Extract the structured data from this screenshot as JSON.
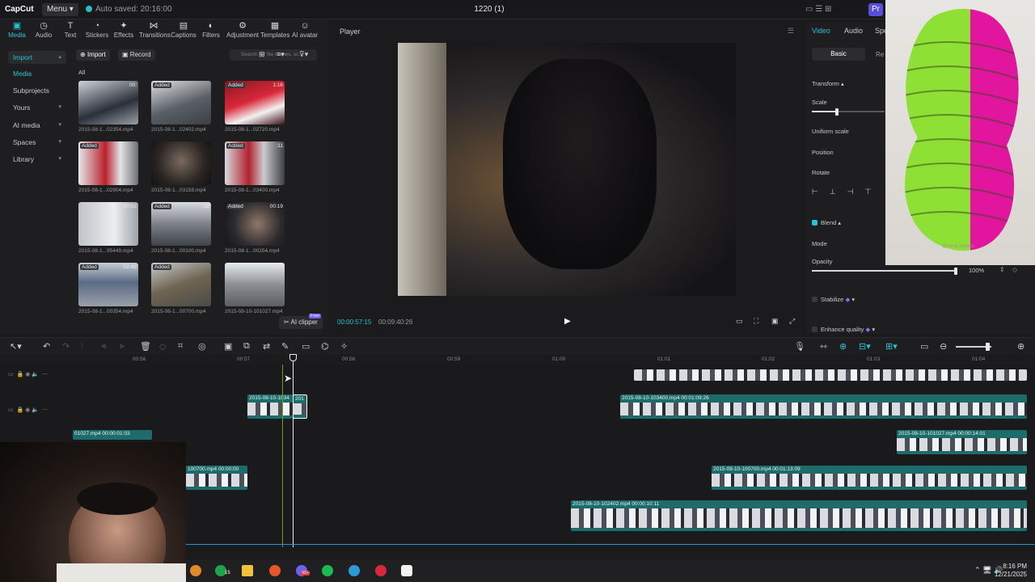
{
  "titlebar": {
    "app_logo": "CapCut",
    "menu_label": "Menu",
    "autosave": "Auto saved: 20:16:00",
    "project_name": "1220 (1)",
    "pro_label": "Pr"
  },
  "toolbar": {
    "items": [
      {
        "label": "Media",
        "icon": "media-icon"
      },
      {
        "label": "Audio",
        "icon": "audio-icon"
      },
      {
        "label": "Text",
        "icon": "text-icon"
      },
      {
        "label": "Stickers",
        "icon": "sticker-icon"
      },
      {
        "label": "Effects",
        "icon": "effects-icon"
      },
      {
        "label": "Transitions",
        "icon": "transitions-icon"
      },
      {
        "label": "Captions",
        "icon": "captions-icon"
      },
      {
        "label": "Filters",
        "icon": "filters-icon"
      },
      {
        "label": "Adjustment",
        "icon": "adjustment-icon"
      },
      {
        "label": "Templates",
        "icon": "templates-icon"
      },
      {
        "label": "AI avatar",
        "icon": "ai-avatar-icon"
      }
    ]
  },
  "leftnav": {
    "items": [
      "Import",
      "Media",
      "Subprojects",
      "Yours",
      "AI media",
      "Spaces",
      "Library"
    ]
  },
  "media": {
    "import_btn": "Import",
    "record_btn": "Record",
    "search_placeholder": "Search for file names, sc...",
    "filter_all": "All",
    "items": [
      {
        "name": "2015-08-1...02354.mp4",
        "badge": "",
        "dur": "00:"
      },
      {
        "name": "2015-08-1...02402.mp4",
        "badge": "Added",
        "dur": ""
      },
      {
        "name": "2015-08-1...02720.mp4",
        "badge": "Added",
        "dur": "1:16"
      },
      {
        "name": "2015-08-1...02904.mp4",
        "badge": "Added",
        "dur": ""
      },
      {
        "name": "2015-08-1...03158.mp4",
        "badge": "",
        "dur": ""
      },
      {
        "name": "2015-08-1...03400.mp4",
        "badge": "Added",
        "dur": ":11"
      },
      {
        "name": "2015-08-1...95449.mp4",
        "badge": "",
        "dur": "00:02"
      },
      {
        "name": "2015-08-1...00100.mp4",
        "badge": "Added",
        "dur": ":32"
      },
      {
        "name": "2015-08-1...00254.mp4",
        "badge": "Added",
        "dur": "00:19"
      },
      {
        "name": "2015-08-1...00354.mp4",
        "badge": "Added",
        "dur": "02:43"
      },
      {
        "name": "2015-08-1...00700.mp4",
        "badge": "Added",
        "dur": ""
      },
      {
        "name": "2015-08-10-101027.mp4",
        "badge": "",
        "dur": ""
      }
    ],
    "ai_clipper": "AI clipper",
    "free_badge": "Free"
  },
  "player": {
    "title": "Player",
    "current_time": "00:00:57:15",
    "total_time": "00:09:40:26"
  },
  "props": {
    "tabs": [
      "Video",
      "Audio",
      "Spe"
    ],
    "subtabs": [
      "Basic",
      "Re"
    ],
    "transform": "Transform",
    "scale": "Scale",
    "uniform_scale": "Uniform scale",
    "position": "Position",
    "rotate": "Rotate",
    "blend": "Blend",
    "mode": "Mode",
    "opacity": "Opacity",
    "opacity_value": "100%",
    "stabilize": "Stabilize",
    "enhance": "Enhance quality",
    "scale_level": 0.34,
    "opacity_level": 1.0
  },
  "toy_watermark": "@sand.tagious",
  "timeline": {
    "ruler": [
      "00:56",
      "00:57",
      "00:58",
      "00:59",
      "01:00",
      "01:01",
      "01:02",
      "01:03",
      "01:04"
    ],
    "clips": [
      {
        "label": "2015-08-10-1034",
        "sub": "201"
      },
      {
        "label": "2015-08-10-103400.mp4  00:01:09:26"
      },
      {
        "label": "01027.mp4  00:00:01:03"
      },
      {
        "label": "2015-08-10-101027.mp4  00:00:14:01"
      },
      {
        "label": "100700.mp4  00:00:00"
      },
      {
        "label": "2015-08-10-100700.mp4  00:01:13:09"
      },
      {
        "label": "2015-08-10-102402.mp4  00:00:10:11"
      }
    ]
  },
  "taskbar": {
    "time": "8:16 PM",
    "date": "12/21/2025",
    "xbox_badge": "15",
    "discord_badge": "99+"
  }
}
